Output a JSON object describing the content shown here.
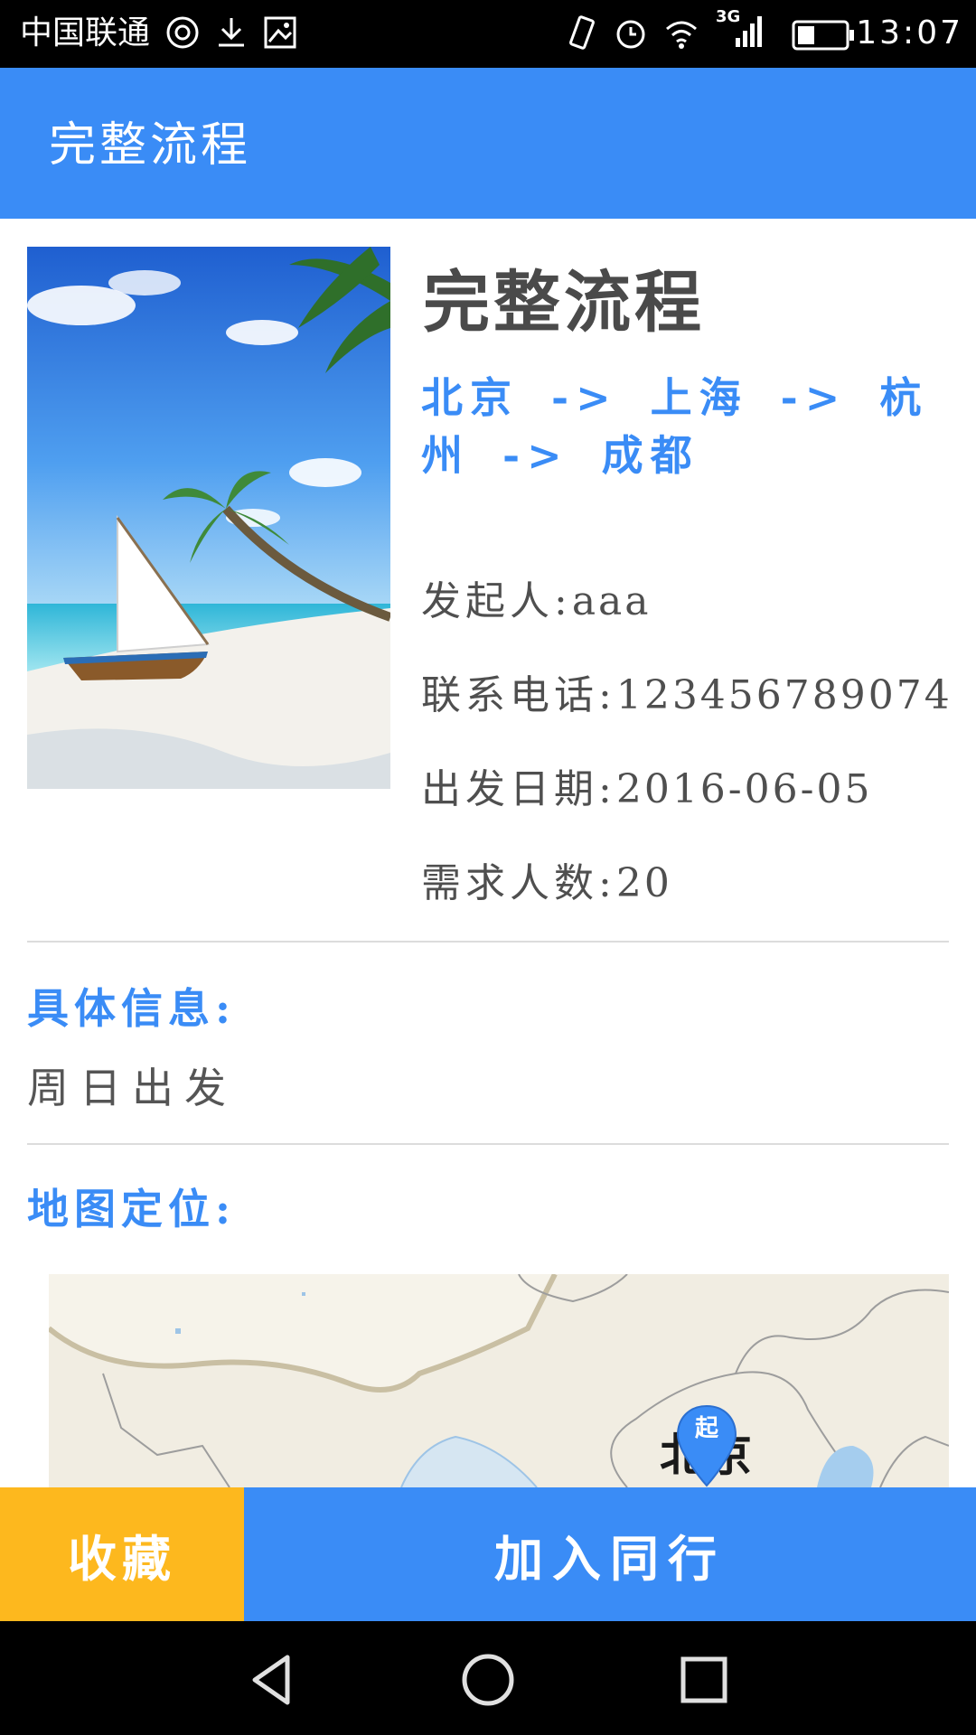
{
  "status_bar": {
    "carrier": "中国联通",
    "network": "3G",
    "time": "13:07",
    "icons": [
      "sync-icon",
      "download-icon",
      "image-icon",
      "vibrate-icon",
      "alarm-icon",
      "wifi-icon",
      "signal-icon",
      "battery-icon"
    ]
  },
  "app_bar": {
    "title": "完整流程"
  },
  "trip": {
    "title": "完整流程",
    "route": "北京 -> 上海 -> 杭州 -> 成都",
    "initiator_label": "发起人:",
    "initiator": "aaa",
    "phone_label": "联系电话:",
    "phone": "123456789074",
    "date_label": "出发日期:",
    "date": "2016-06-05",
    "people_label": "需求人数:",
    "people": "20"
  },
  "details": {
    "label": "具体信息:",
    "text": "周日出发"
  },
  "map": {
    "label": "地图定位:",
    "city": "北京",
    "marker": "起"
  },
  "actions": {
    "collect": "收藏",
    "join": "加入同行"
  },
  "colors": {
    "primary": "#3a8cf6",
    "accent": "#fdb81e"
  },
  "nav_icons": [
    "back-icon",
    "home-icon",
    "recents-icon"
  ]
}
